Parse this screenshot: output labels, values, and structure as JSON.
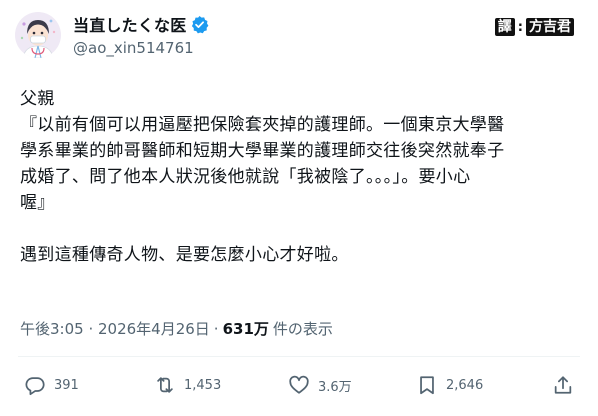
{
  "author": {
    "display_name": "当直したくな医",
    "handle": "@ao_xin514761",
    "verified": true
  },
  "watermark": {
    "tag": "譯",
    "name": "方吉君"
  },
  "post": {
    "lines": [
      "父親",
      "『以前有個可以用逼壓把保險套夾掉的護理師。一個東京大學醫",
      "學系畢業的帥哥醫師和短期大學畢業的護理師交往後突然就奉子",
      "成婚了、問了他本人狀況後他就說「我被陰了。。。」。要小心",
      "喔』",
      "",
      "遇到這種傳奇人物、是要怎麼小心才好啦。"
    ]
  },
  "meta": {
    "timestamp": "午後3:05 · 2026年4月26日",
    "separator": "·",
    "views_count": "631万",
    "views_label": "件の表示"
  },
  "actions": {
    "reply_count": "391",
    "repost_count": "1,453",
    "like_count": "3.6万",
    "bookmark_count": "2,646"
  },
  "colors": {
    "text": "#0f1419",
    "secondary": "#536471",
    "verified": "#1d9bf0",
    "divider": "#eff3f4"
  }
}
